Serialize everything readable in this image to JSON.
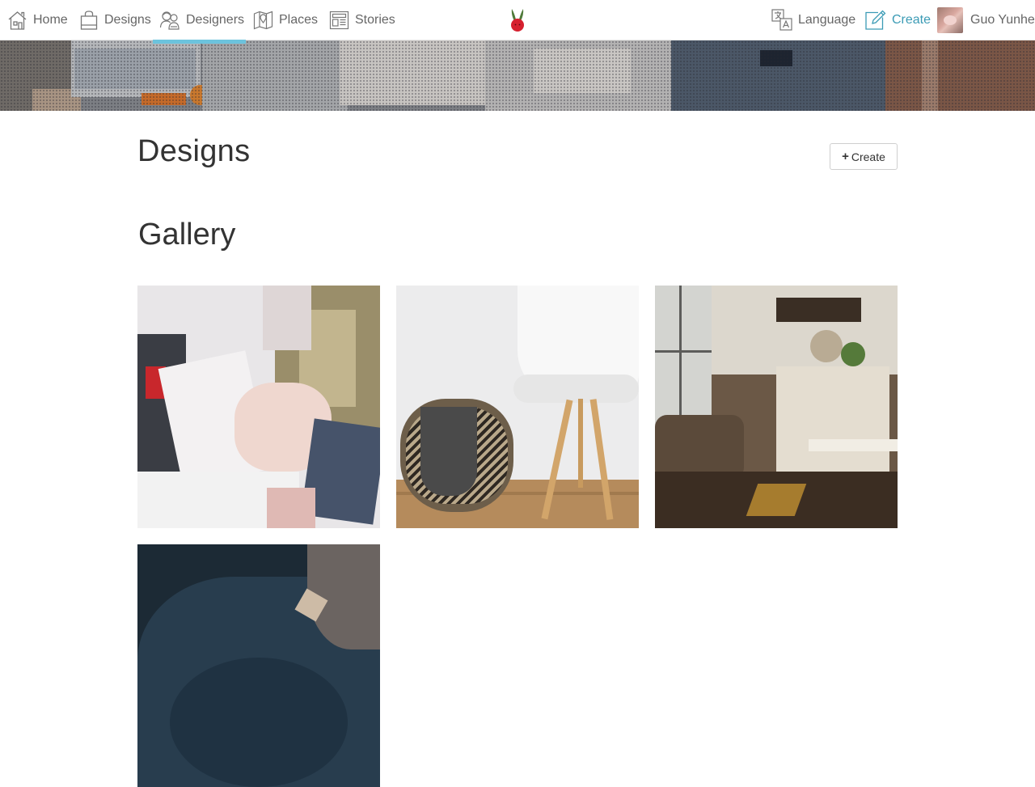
{
  "nav": {
    "home": {
      "label": "Home",
      "icon": "home-icon"
    },
    "designs": {
      "label": "Designs",
      "icon": "shopping-bag-icon"
    },
    "designers": {
      "label": "Designers",
      "icon": "designers-icon"
    },
    "places": {
      "label": "Places",
      "icon": "map-icon"
    },
    "stories": {
      "label": "Stories",
      "icon": "newspaper-icon"
    },
    "language": {
      "label": "Language",
      "icon": "translate-icon"
    },
    "create": {
      "label": "Create",
      "icon": "edit-icon"
    },
    "user": {
      "name": "Guo Yunhe"
    }
  },
  "colors": {
    "accent": "#3b9bb5",
    "active_tab_bar": "#6cc3dd",
    "logo_red": "#d6202f",
    "logo_green": "#4f7a3a"
  },
  "page": {
    "title": "Designs",
    "create_button": "Create"
  },
  "gallery": {
    "title": "Gallery",
    "items": [
      {
        "subject": "craft supplies flat lay"
      },
      {
        "subject": "white chair and woven basket"
      },
      {
        "subject": "vintage shop interior"
      },
      {
        "subject": "dark fabric detail"
      }
    ]
  }
}
